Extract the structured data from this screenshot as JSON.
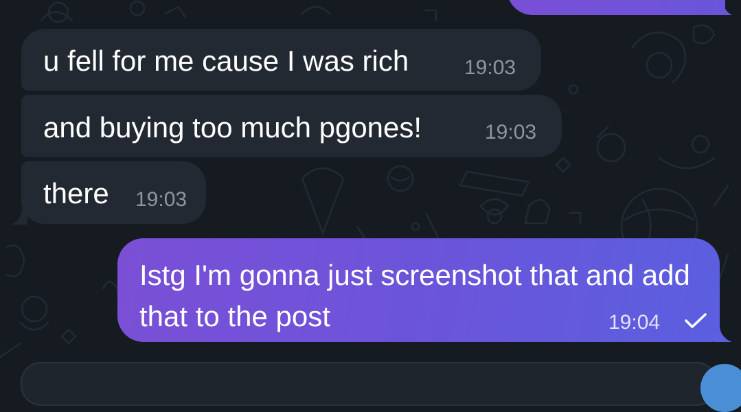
{
  "messages": [
    {
      "direction": "incoming",
      "text": "u fell for me cause I was rich",
      "time": "19:03"
    },
    {
      "direction": "incoming",
      "text": "and buying too much pgones!",
      "time": "19:03"
    },
    {
      "direction": "incoming",
      "text": "there",
      "time": "19:03"
    },
    {
      "direction": "outgoing",
      "text": "Istg I'm gonna just screenshot that and add that to the post",
      "time": "19:04",
      "status": "sent-check-icon"
    }
  ],
  "colors": {
    "background": "#151b21",
    "incoming_bubble": "#232932",
    "outgoing_bubble_start": "#7a4fd6",
    "outgoing_bubble_end": "#5b5fe0",
    "incoming_time": "#8d96a1",
    "accent": "#4a8fd6"
  }
}
